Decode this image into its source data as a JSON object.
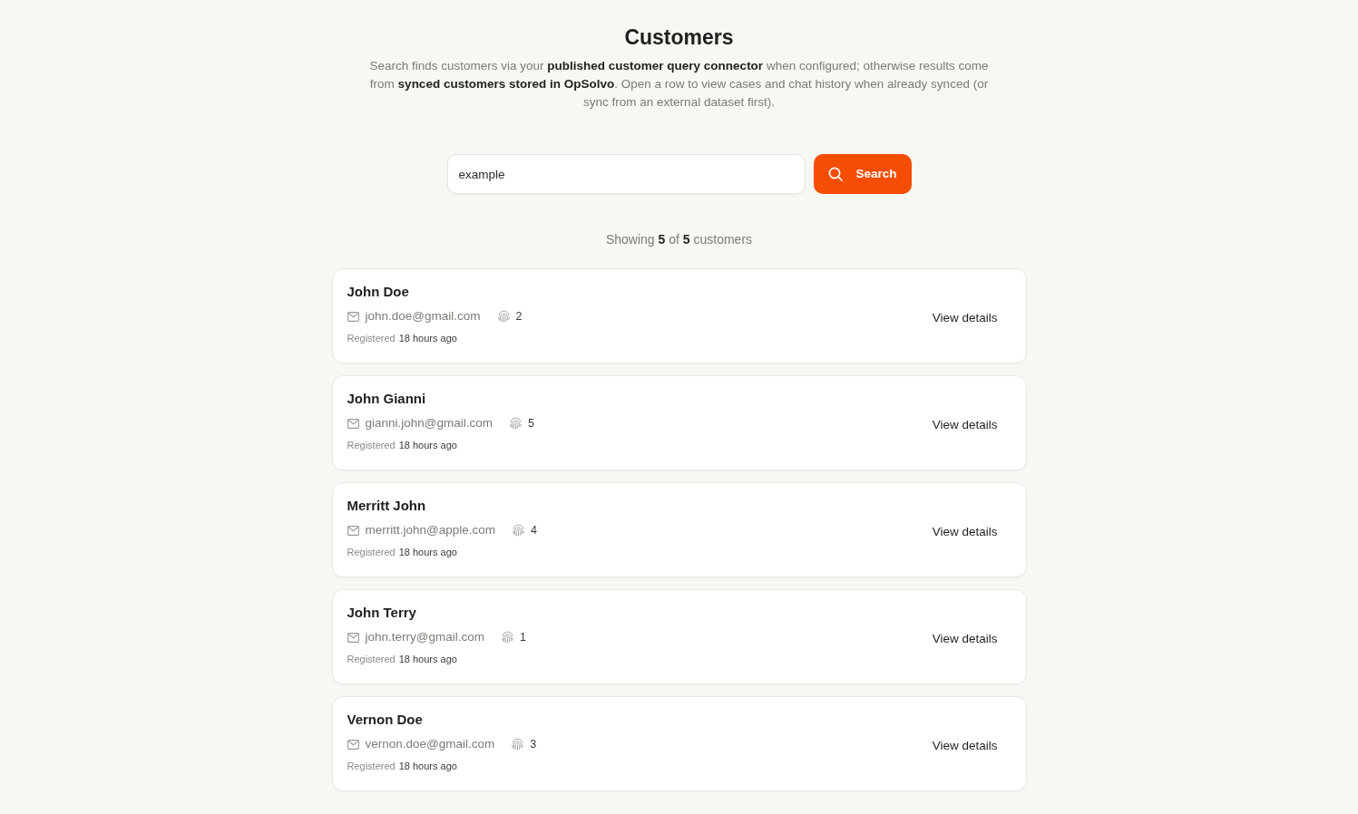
{
  "page": {
    "title": "Customers",
    "description": "Search finds customers via your **published customer query connector** when configured; otherwise results come from **synced customers stored in OpSolvo**. Open a row to view cases and chat history when already synced (or sync from an external dataset first)."
  },
  "search": {
    "value": "example",
    "button": "Search"
  },
  "summary": "Showing **5** of **5** customers",
  "customers": [
    {
      "name": "John Doe",
      "email": "john.doe@gmail.com",
      "count": "2",
      "registered_label": "Registered",
      "registered": "18 hours ago",
      "action": "View details"
    },
    {
      "name": "John Gianni",
      "email": "gianni.john@gmail.com",
      "count": "5",
      "registered_label": "Registered",
      "registered": "18 hours ago",
      "action": "View details"
    },
    {
      "name": "Merritt John",
      "email": "merritt.john@apple.com",
      "count": "4",
      "registered_label": "Registered",
      "registered": "18 hours ago",
      "action": "View details"
    },
    {
      "name": "John Terry",
      "email": "john.terry@gmail.com",
      "count": "1",
      "registered_label": "Registered",
      "registered": "18 hours ago",
      "action": "View details"
    },
    {
      "name": "Vernon Doe",
      "email": "vernon.doe@gmail.com",
      "count": "3",
      "registered_label": "Registered",
      "registered": "18 hours ago",
      "action": "View details"
    }
  ]
}
